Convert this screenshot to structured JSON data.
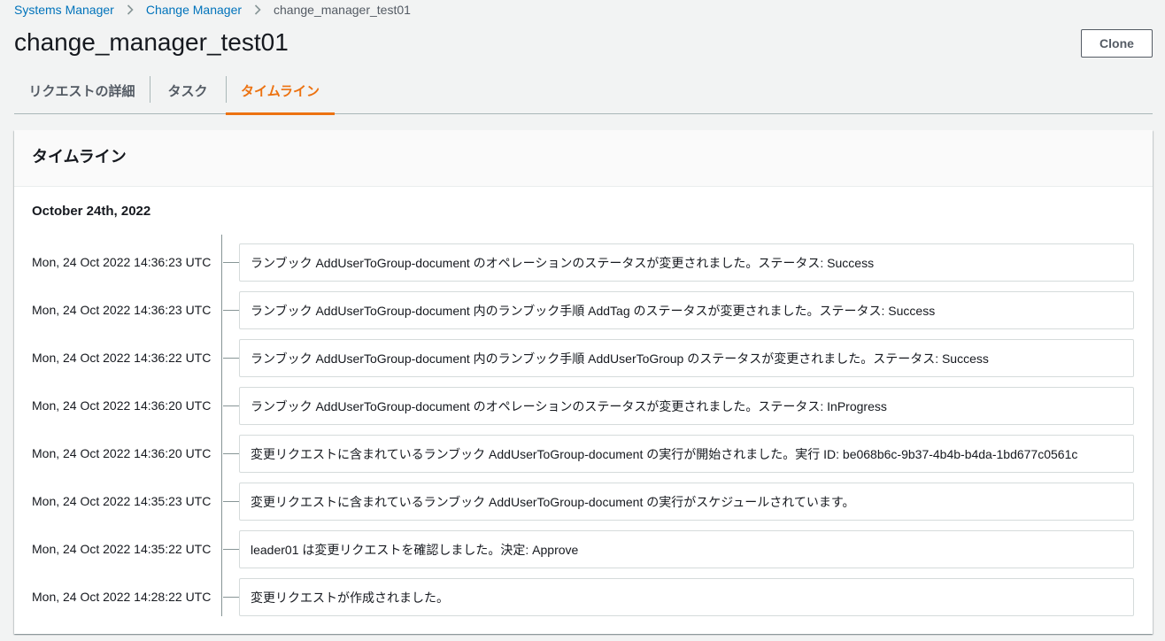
{
  "breadcrumb": {
    "items": [
      "Systems Manager",
      "Change Manager"
    ],
    "current": "change_manager_test01"
  },
  "header": {
    "title": "change_manager_test01",
    "clone_label": "Clone"
  },
  "tabs": [
    {
      "label": "リクエストの詳細",
      "active": false
    },
    {
      "label": "タスク",
      "active": false
    },
    {
      "label": "タイムライン",
      "active": true
    }
  ],
  "colors": {
    "link": "#0073bb",
    "accent": "#ec7211",
    "text": "#16191f",
    "secondary_text": "#545b64",
    "background": "#f2f3f3",
    "border": "#d5dbdb"
  },
  "icons": {
    "breadcrumb_separator": "chevron-right-icon"
  },
  "timeline": {
    "title": "タイムライン",
    "date": "October 24th, 2022",
    "events": [
      {
        "time": "Mon, 24 Oct 2022 14:36:23 UTC",
        "message": "ランブック AddUserToGroup-document のオペレーションのステータスが変更されました。ステータス: Success"
      },
      {
        "time": "Mon, 24 Oct 2022 14:36:23 UTC",
        "message": "ランブック AddUserToGroup-document 内のランブック手順 AddTag のステータスが変更されました。ステータス: Success"
      },
      {
        "time": "Mon, 24 Oct 2022 14:36:22 UTC",
        "message": "ランブック AddUserToGroup-document 内のランブック手順 AddUserToGroup のステータスが変更されました。ステータス: Success"
      },
      {
        "time": "Mon, 24 Oct 2022 14:36:20 UTC",
        "message": "ランブック AddUserToGroup-document のオペレーションのステータスが変更されました。ステータス: InProgress"
      },
      {
        "time": "Mon, 24 Oct 2022 14:36:20 UTC",
        "message": "変更リクエストに含まれているランブック AddUserToGroup-document の実行が開始されました。実行 ID: be068b6c-9b37-4b4b-b4da-1bd677c0561c"
      },
      {
        "time": "Mon, 24 Oct 2022 14:35:23 UTC",
        "message": "変更リクエストに含まれているランブック AddUserToGroup-document の実行がスケジュールされています。"
      },
      {
        "time": "Mon, 24 Oct 2022 14:35:22 UTC",
        "message": "leader01 は変更リクエストを確認しました。決定: Approve"
      },
      {
        "time": "Mon, 24 Oct 2022 14:28:22 UTC",
        "message": "変更リクエストが作成されました。"
      }
    ]
  }
}
